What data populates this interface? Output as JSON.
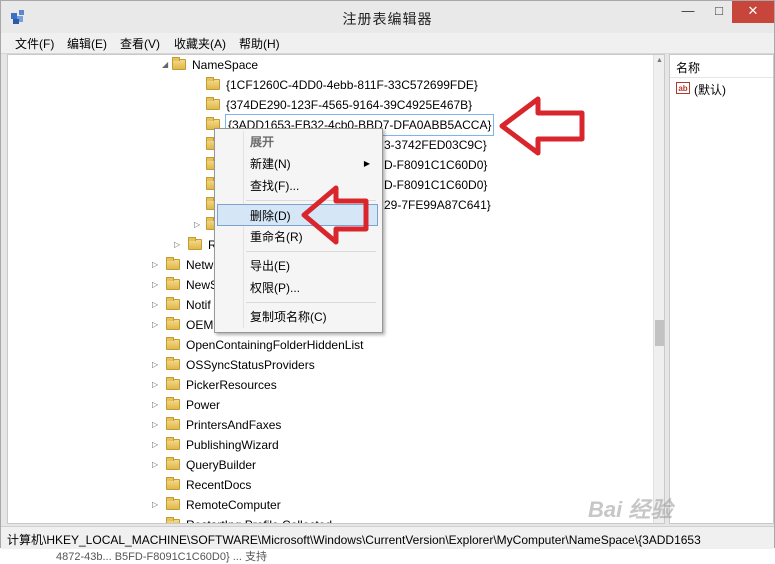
{
  "window": {
    "title": "注册表编辑器",
    "min_glyph": "—",
    "max_glyph": "□",
    "close_glyph": "✕"
  },
  "menu": [
    {
      "label": "文件(F)"
    },
    {
      "label": "编辑(E)"
    },
    {
      "label": "查看(V)"
    },
    {
      "label": "收藏夹(A)"
    },
    {
      "label": "帮助(H)"
    }
  ],
  "tree": {
    "namespace": "NameSpace",
    "children": [
      "{1CF1260C-4DD0-4ebb-811F-33C572699FDE}",
      "{374DE290-123F-4565-9164-39C4925E467B}",
      "{3ADD1653-EB32-4cb0-BBD7-DFA0ABB5ACCA}",
      "3-3742FED03C9C}",
      "D-F8091C1C60D0}",
      "D-F8091C1C60D0}",
      "29-7FE99A87C641}"
    ],
    "re_partial": "Re",
    "siblings": [
      "Netw",
      "NewS",
      "Notif",
      "OEM",
      "OpenContainingFolderHiddenList",
      "OSSyncStatusProviders",
      "PickerResources",
      "Power",
      "PrintersAndFaxes",
      "PublishingWizard",
      "QueryBuilder",
      "RecentDocs",
      "RemoteComputer",
      "RestartIng.Profile.Collected"
    ]
  },
  "data_pane": {
    "column_name": "名称",
    "rows": [
      {
        "icon_text": "ab",
        "name": "(默认)"
      }
    ]
  },
  "context_menu": {
    "items": [
      {
        "label": "展开",
        "style": "bold"
      },
      {
        "label": "新建(N)",
        "submenu": true
      },
      {
        "label": "查找(F)..."
      },
      {
        "label": "删除(D)",
        "highlighted": true
      },
      {
        "label": "重命名(R)"
      },
      {
        "label": "导出(E)"
      },
      {
        "label": "权限(P)..."
      },
      {
        "label": "复制项名称(C)"
      }
    ]
  },
  "status_bar": "计算机\\HKEY_LOCAL_MACHINE\\SOFTWARE\\Microsoft\\Windows\\CurrentVersion\\Explorer\\MyComputer\\NameSpace\\{3ADD1653",
  "bottom_bleed": "4872-43b... B5FD-F8091C1C60D0}   ... 支持",
  "watermark": {
    "text": "Bai 经验"
  },
  "annotation_color": "#d9262c"
}
